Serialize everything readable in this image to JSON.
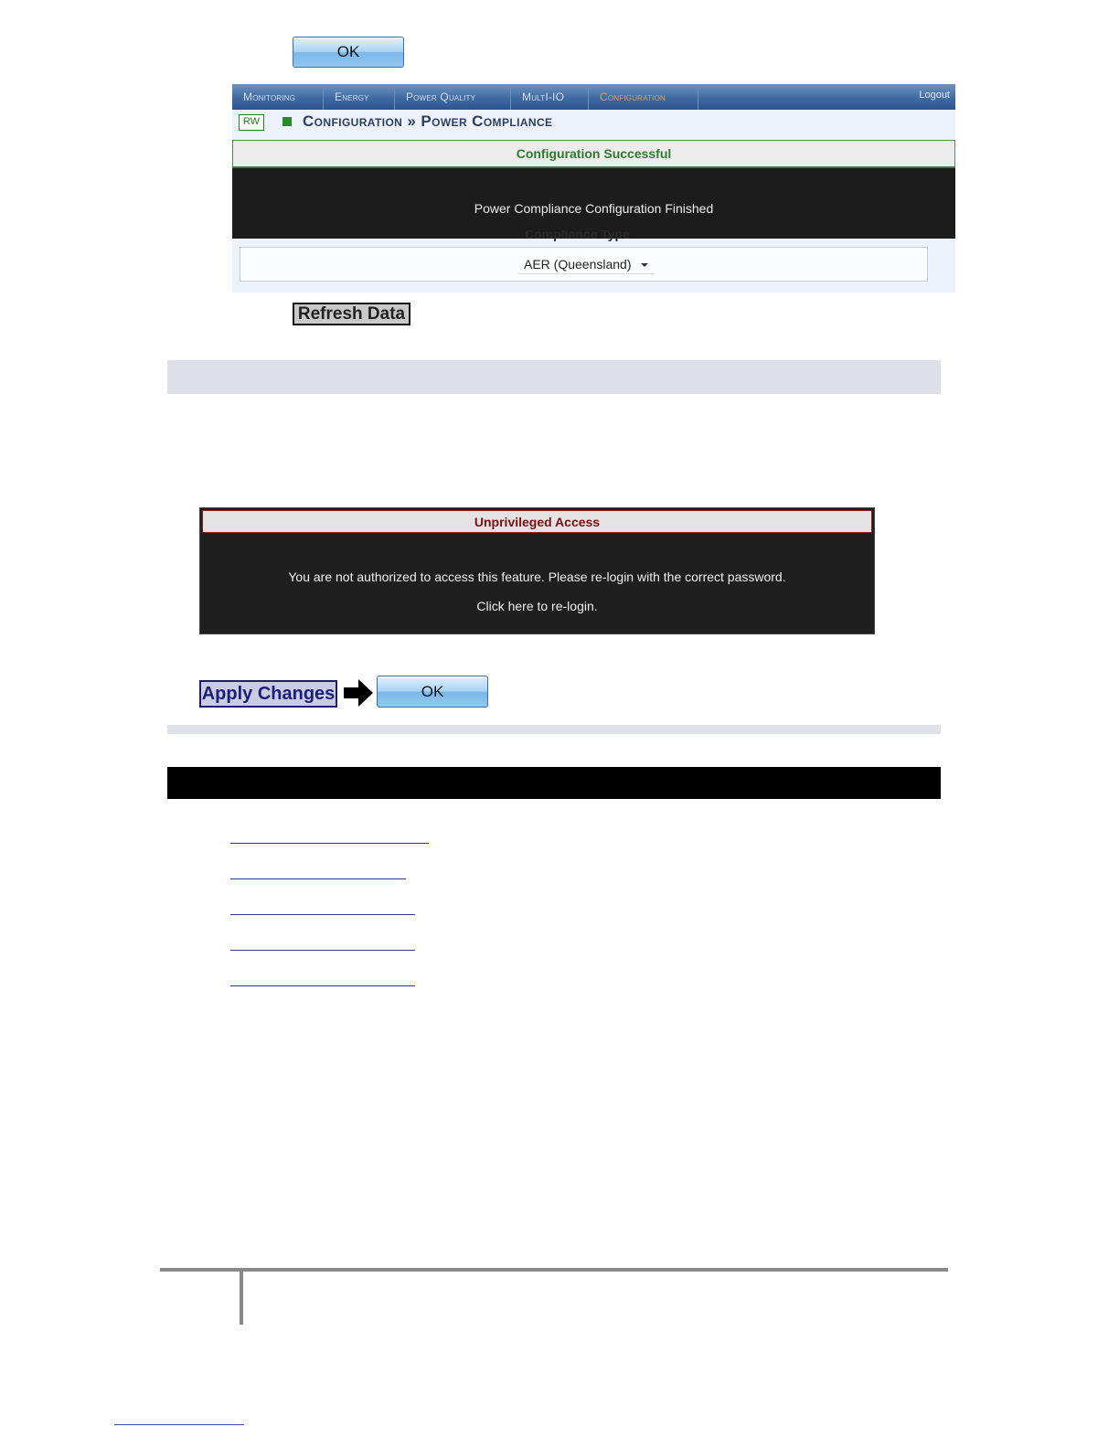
{
  "top_ok": {
    "label": "OK"
  },
  "ui_screenshot": {
    "nav_tabs": [
      "Monitoring",
      "Energy",
      "Power Quality",
      "MultI-IO",
      "Configuration"
    ],
    "logout": "Logout",
    "rw_badge": "RW",
    "breadcrumb": "Configuration » Power Compliance",
    "success_title": "Configuration Successful",
    "success_message": "Power Compliance Configuration Finished",
    "partial_label": "Compliance Type",
    "compliance_type": "AER (Queensland)"
  },
  "refresh_button": {
    "label": "Refresh Data"
  },
  "unprivileged_dialog": {
    "title": "Unprivileged Access",
    "message": "You are not authorized to access this feature. Please re-login with the correct password.",
    "relogin": "Click here to re-login."
  },
  "apply_row": {
    "apply_label": "Apply Changes",
    "ok_label": "OK"
  },
  "colors": {
    "nav_blue": "#3f6aa2",
    "active_tab": "#e0a04a",
    "success_green": "#2d7a2d",
    "warning_red": "#7a1010",
    "apply_navy": "#1d1d7a"
  }
}
